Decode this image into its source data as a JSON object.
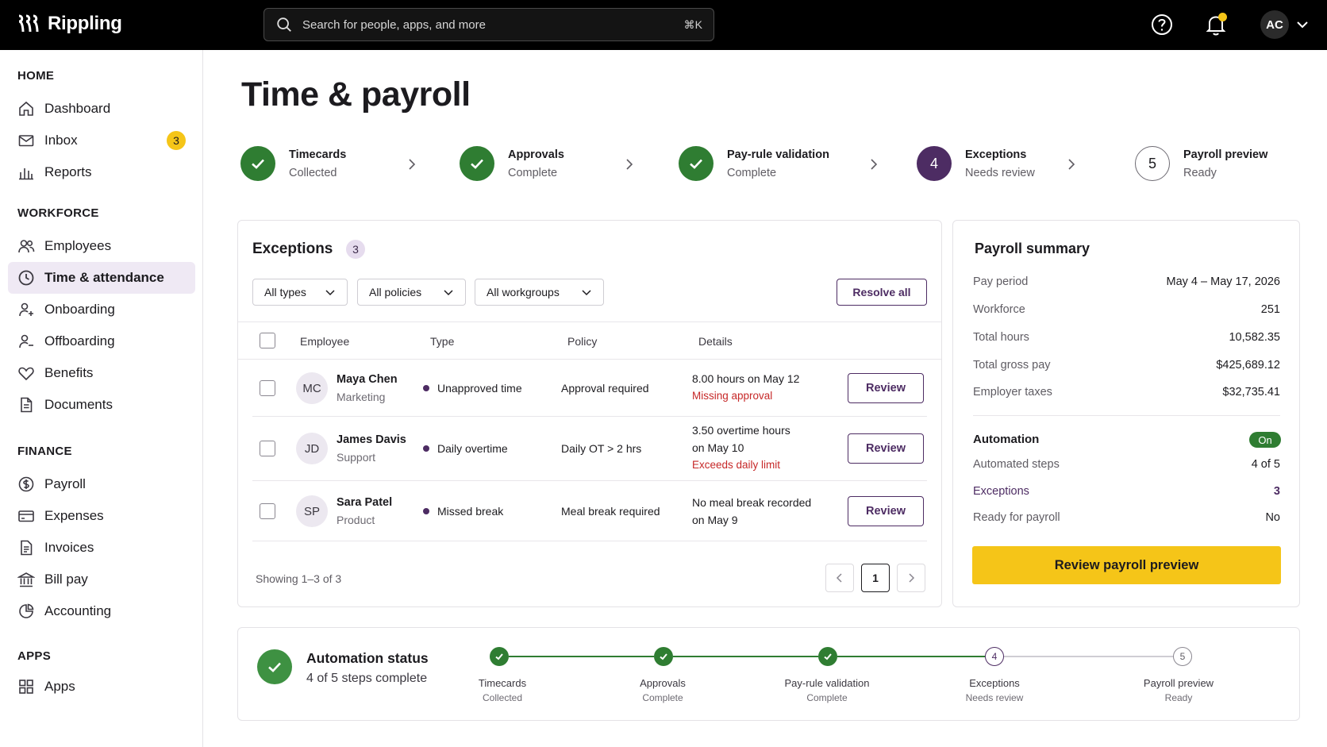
{
  "app": {
    "name": "Rippling"
  },
  "search": {
    "placeholder": "Search for people, apps, and more",
    "shortcut": "⌘K"
  },
  "user": {
    "initials": "AC"
  },
  "sidebar": {
    "sections": [
      {
        "title": "HOME",
        "items": [
          {
            "label": "Dashboard",
            "icon": "home-icon"
          },
          {
            "label": "Inbox",
            "icon": "inbox-icon",
            "badge": "3"
          },
          {
            "label": "Reports",
            "icon": "bar-chart-icon"
          }
        ]
      },
      {
        "title": "WORKFORCE",
        "items": [
          {
            "label": "Employees",
            "icon": "people-icon"
          },
          {
            "label": "Time & attendance",
            "icon": "clock-icon",
            "active": true
          },
          {
            "label": "Onboarding",
            "icon": "user-plus-icon"
          },
          {
            "label": "Offboarding",
            "icon": "user-minus-icon"
          },
          {
            "label": "Benefits",
            "icon": "heart-icon"
          },
          {
            "label": "Documents",
            "icon": "document-icon"
          }
        ]
      },
      {
        "title": "FINANCE",
        "items": [
          {
            "label": "Payroll",
            "icon": "dollar-circle-icon"
          },
          {
            "label": "Expenses",
            "icon": "credit-card-icon"
          },
          {
            "label": "Invoices",
            "icon": "invoice-icon"
          },
          {
            "label": "Bill pay",
            "icon": "bank-icon"
          },
          {
            "label": "Accounting",
            "icon": "pie-chart-icon"
          }
        ]
      },
      {
        "title": "APPS",
        "items": [
          {
            "label": "Apps",
            "icon": "grid-icon"
          }
        ]
      }
    ]
  },
  "page": {
    "title": "Time & payroll"
  },
  "steps": [
    {
      "label": "Timecards",
      "status": "Collected",
      "state": "done"
    },
    {
      "label": "Approvals",
      "status": "Complete",
      "state": "done"
    },
    {
      "label": "Pay-rule validation",
      "status": "Complete",
      "state": "done"
    },
    {
      "label": "Exceptions",
      "status": "Needs review",
      "state": "current",
      "number": "4"
    },
    {
      "label": "Payroll preview",
      "status": "Ready",
      "state": "todo",
      "number": "5"
    }
  ],
  "exceptions": {
    "title": "Exceptions",
    "count": "3",
    "filters": [
      "All types",
      "All policies",
      "All workgroups"
    ],
    "resolve_label": "Resolve all",
    "columns": [
      "Employee",
      "Type",
      "Policy",
      "Details"
    ],
    "rows": [
      {
        "initials": "MC",
        "name": "Maya Chen",
        "dept": "Marketing",
        "type": "Unapproved time",
        "policy": "Approval required",
        "detail_lines": [
          "8.00 hours on May 12"
        ],
        "error": "Missing approval",
        "action": "Review"
      },
      {
        "initials": "JD",
        "name": "James Davis",
        "dept": "Support",
        "type": "Daily overtime",
        "policy": "Daily OT > 2 hrs",
        "detail_lines": [
          "3.50 overtime hours",
          "on May 10"
        ],
        "error": "Exceeds daily limit",
        "action": "Review"
      },
      {
        "initials": "SP",
        "name": "Sara Patel",
        "dept": "Product",
        "type": "Missed break",
        "policy": "Meal break required",
        "detail_lines": [
          "No meal break recorded",
          "on May 9"
        ],
        "error": "",
        "action": "Review"
      }
    ],
    "showing": "Showing 1–3 of 3",
    "current_page": "1"
  },
  "summary": {
    "title": "Payroll summary",
    "rows": [
      {
        "label": "Pay period",
        "value": "May 4 – May 17, 2026"
      },
      {
        "label": "Workforce",
        "value": "251"
      },
      {
        "label": "Total hours",
        "value": "10,582.35"
      },
      {
        "label": "Total gross pay",
        "value": "$425,689.12"
      },
      {
        "label": "Employer taxes",
        "value": "$32,735.41"
      }
    ],
    "automation": {
      "title": "Automation",
      "status": "On",
      "rows": [
        {
          "label": "Automated steps",
          "value": "4 of 5"
        },
        {
          "label": "Exceptions",
          "value": "3",
          "accent": true
        },
        {
          "label": "Ready for payroll",
          "value": "No"
        }
      ]
    },
    "cta": "Review payroll preview"
  },
  "automation_status": {
    "title": "Automation status",
    "subtitle": "4 of 5 steps complete"
  },
  "colors": {
    "brand_purple": "#4d2c63",
    "success_green": "#2f7d32",
    "accent_yellow": "#f5c518",
    "error_red": "#c62828"
  }
}
